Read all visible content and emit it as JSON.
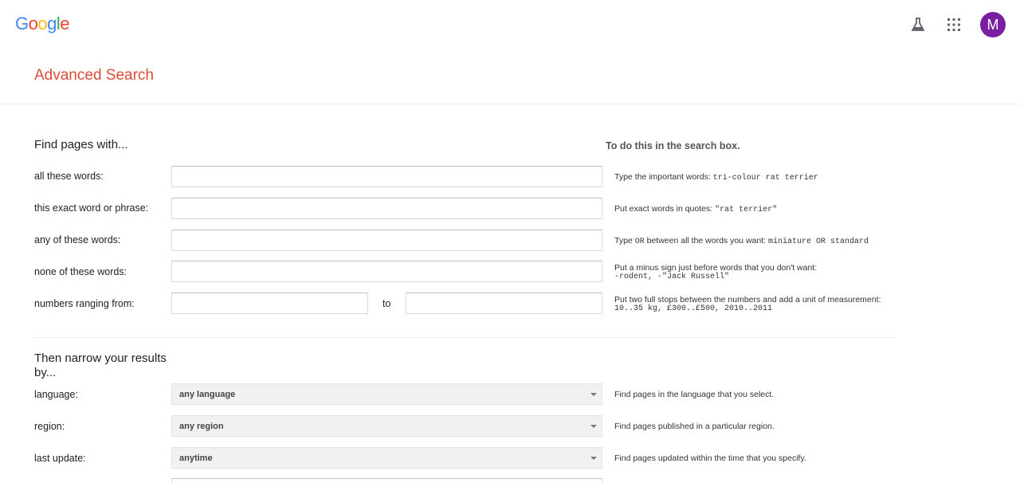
{
  "header": {
    "logo_letters": [
      {
        "ch": "G",
        "color": "#4285F4"
      },
      {
        "ch": "o",
        "color": "#EA4335"
      },
      {
        "ch": "o",
        "color": "#FBBC05"
      },
      {
        "ch": "g",
        "color": "#4285F4"
      },
      {
        "ch": "l",
        "color": "#34A853"
      },
      {
        "ch": "e",
        "color": "#EA4335"
      }
    ],
    "icons": [
      "labs-flask-icon",
      "apps-grid-icon"
    ],
    "avatar_letter": "M",
    "avatar_color": "#7b1fa2"
  },
  "page_title": "Advanced Search",
  "find_section": {
    "heading": "Find pages with...",
    "hint_heading": "To do this in the search box.",
    "rows": [
      {
        "label": "all these words:",
        "value": "",
        "hint_text": "Type the important words: ",
        "hint_mono": "tri-colour rat terrier"
      },
      {
        "label": "this exact word or phrase:",
        "value": "",
        "hint_text": "Put exact words in quotes: ",
        "hint_mono": "\"rat terrier\""
      },
      {
        "label": "any of these words:",
        "value": "",
        "hint_text_1": "Type ",
        "hint_mono_1": "OR",
        "hint_text_2": " between all the words you want: ",
        "hint_mono_2": "miniature OR standard"
      },
      {
        "label": "none of these words:",
        "value": "",
        "hint_text": "Put a minus sign just before words that you don't want:",
        "hint_mono": "-rodent, -\"Jack Russell\""
      },
      {
        "label": "numbers ranging from:",
        "from_value": "",
        "to_label": "to",
        "to_value": "",
        "hint_text": "Put two full stops between the numbers and add a unit of measurement:",
        "hint_mono": "10..35 kg, £300..£500, 2010..2011"
      }
    ]
  },
  "narrow_section": {
    "heading": "Then narrow your results by...",
    "rows": [
      {
        "label": "language:",
        "selected": "any language",
        "hint": "Find pages in the language that you select."
      },
      {
        "label": "region:",
        "selected": "any region",
        "hint": "Find pages published in a particular region."
      },
      {
        "label": "last update:",
        "selected": "anytime",
        "hint": "Find pages updated within the time that you specify."
      }
    ]
  }
}
